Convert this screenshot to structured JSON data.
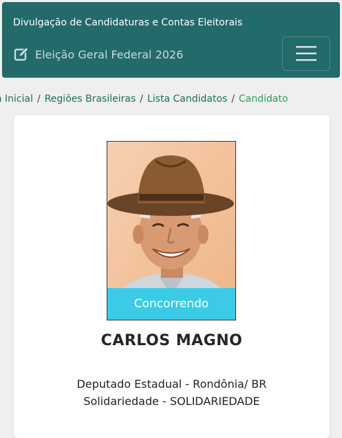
{
  "header": {
    "site_title": "Divulgação de Candidaturas e Contas Eleitorais",
    "election_label": "Eleição Geral Federal 2026",
    "edit_icon": "edit-square-icon",
    "menu_icon": "hamburger-menu-icon"
  },
  "breadcrumb": {
    "items": [
      "Página Inicial",
      "Regiões Brasileiras",
      "Lista Candidatos"
    ],
    "visible_first_item": "a Inicial",
    "current": "Candidato",
    "separator": "/"
  },
  "candidate": {
    "name": "CARLOS MAGNO",
    "status": "Concorrendo",
    "office": "Deputado Estadual - Rondônia/ BR",
    "party": "Solidariedade - SOLIDARIEDADE",
    "photo": "candidate-portrait-with-hat"
  },
  "colors": {
    "header_bg": "#236a6a",
    "badge_bg": "#3ccbe6",
    "link": "#1e6e5e",
    "current_crumb": "#2e9e5e"
  }
}
